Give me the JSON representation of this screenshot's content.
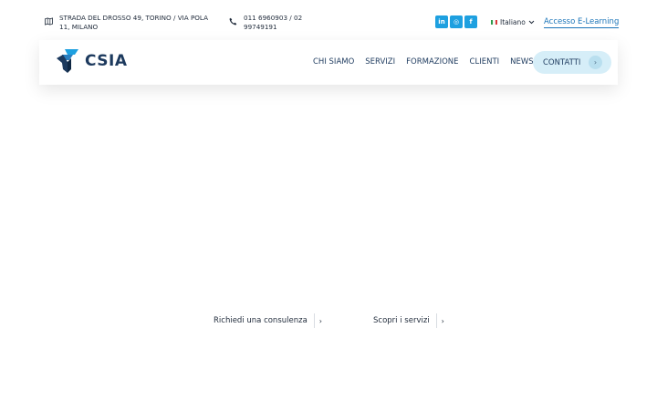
{
  "topbar": {
    "address": "STRADA DEL DROSSO 49, TORINO / VIA POLA 11, MILANO",
    "address_icon": "map-icon",
    "phone": "011 6960903 / 02 99749191",
    "phone_icon": "phone-icon",
    "socials": [
      {
        "name": "linkedin",
        "glyph": "in"
      },
      {
        "name": "instagram",
        "glyph": "◎"
      },
      {
        "name": "facebook",
        "glyph": "f"
      }
    ],
    "language": "Italiano",
    "elearning": "Accesso E-Learning"
  },
  "navbar": {
    "logo_text": "CSIA",
    "menu": [
      "CHI SIAMO",
      "SERVIZI",
      "FORMAZIONE",
      "CLIENTI",
      "NEWS"
    ],
    "cta": "CONTATTI",
    "cta_arrow": "›"
  },
  "hero": {
    "link_consulenza": "Richiedi una consulenza",
    "link_servizi": "Scopri i servizi",
    "chevron": "›"
  },
  "colors": {
    "accent": "#1ea0e0",
    "brand": "#1d3a5e",
    "cta_bg": "#d6eef8",
    "link": "#1a74b8"
  }
}
